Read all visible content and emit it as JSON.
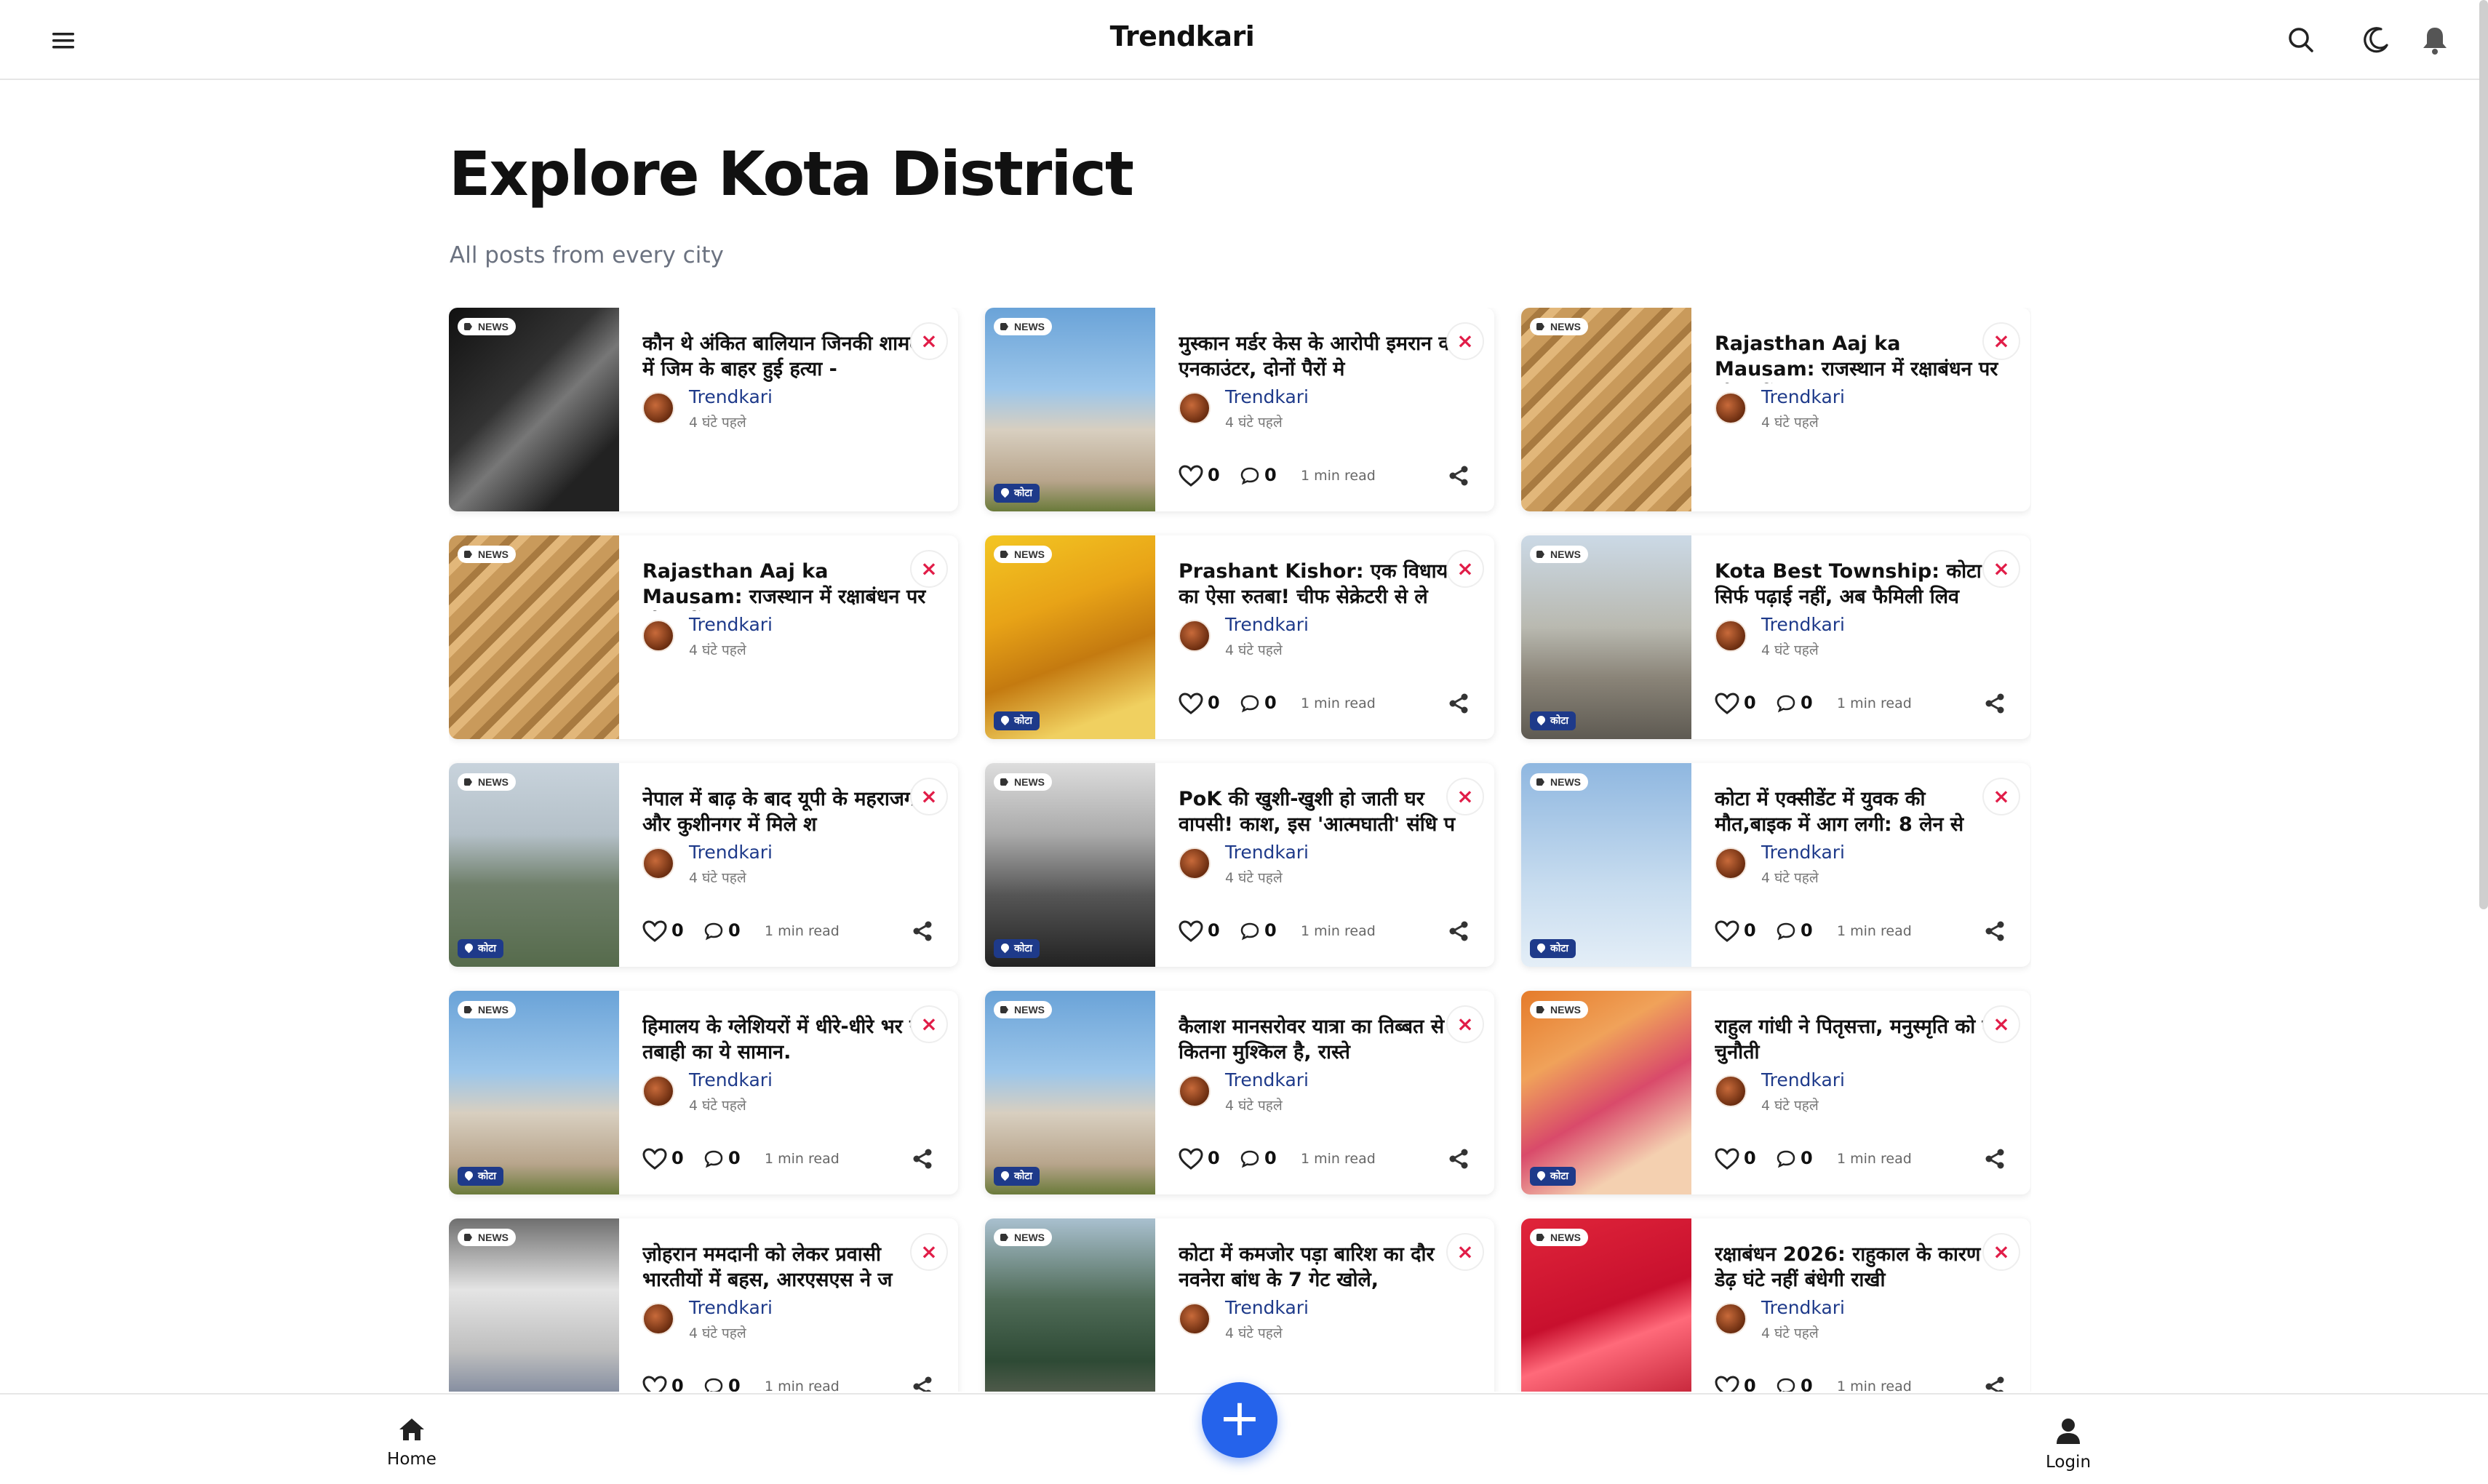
{
  "header": {
    "brand": "Trendkari"
  },
  "hero": {
    "title": "Explore Kota District",
    "subtitle": "All posts from every city"
  },
  "cards": [
    {
      "tag": "NEWS",
      "location": "",
      "title": "कौन थे अंकित बालियान जिनकी शामली में जिम के बाहर हुई हत्या -",
      "author": "Trendkari",
      "time": "4 घंटे पहले",
      "likes": "",
      "comments": "",
      "read": "",
      "theme": "gym"
    },
    {
      "tag": "NEWS",
      "location": "कोटा",
      "title": "मुस्कान मर्डर केस के आरोपी इमरान का एनकाउंटर, दोनों पैरों मे",
      "author": "Trendkari",
      "time": "4 घंटे पहले",
      "likes": "0",
      "comments": "0",
      "read": "1 min read",
      "theme": "taj"
    },
    {
      "tag": "NEWS",
      "location": "",
      "title": "Rajasthan Aaj ka Mausam: राजस्थान में रक्षाबंधन पर भी बरसेंग",
      "author": "Trendkari",
      "time": "4 घंटे पहले",
      "likes": "",
      "comments": "",
      "read": "",
      "theme": "stepwell"
    },
    {
      "tag": "NEWS",
      "location": "",
      "title": "Rajasthan Aaj ka Mausam: राजस्थान में रक्षाबंधन पर भी बरसेंग",
      "author": "Trendkari",
      "time": "4 घंटे पहले",
      "likes": "",
      "comments": "",
      "read": "",
      "theme": "stepwell"
    },
    {
      "tag": "NEWS",
      "location": "कोटा",
      "title": "Prashant Kishor: एक विधायक का ऐसा रुतबा! चीफ सेक्रेटरी से ले",
      "author": "Trendkari",
      "time": "4 घंटे पहले",
      "likes": "0",
      "comments": "0",
      "read": "1 min read",
      "theme": "crowd"
    },
    {
      "tag": "NEWS",
      "location": "कोटा",
      "title": "Kota Best Township: कोटा में सिर्फ पढ़ाई नहीं, अब फैमिली लिव",
      "author": "Trendkari",
      "time": "4 घंटे पहले",
      "likes": "0",
      "comments": "0",
      "read": "1 min read",
      "theme": "street"
    },
    {
      "tag": "NEWS",
      "location": "कोटा",
      "title": "नेपाल में बाढ़ के बाद यूपी के महराजगंज और कुशीनगर में मिले श",
      "author": "Trendkari",
      "time": "4 घंटे पहले",
      "likes": "0",
      "comments": "0",
      "read": "1 min read",
      "theme": "flood"
    },
    {
      "tag": "NEWS",
      "location": "कोटा",
      "title": "PoK की खुशी-खुशी हो जाती घर वापसी! काश, इस 'आत्मघाती' संधि प",
      "author": "Trendkari",
      "time": "4 घंटे पहले",
      "likes": "0",
      "comments": "0",
      "read": "1 min read",
      "theme": "protest"
    },
    {
      "tag": "NEWS",
      "location": "कोटा",
      "title": "कोटा में एक्सीडेंट में युवक की मौत,बाइक में आग लगी: 8 लेन से",
      "author": "Trendkari",
      "time": "4 घंटे पहले",
      "likes": "0",
      "comments": "0",
      "read": "1 min read",
      "theme": "plane"
    },
    {
      "tag": "NEWS",
      "location": "कोटा",
      "title": "हिमालय के ग्लेशियरों में धीरे-धीरे भर रहा तबाही का ये सामान.",
      "author": "Trendkari",
      "time": "4 घंटे पहले",
      "likes": "0",
      "comments": "0",
      "read": "1 min read",
      "theme": "taj"
    },
    {
      "tag": "NEWS",
      "location": "कोटा",
      "title": "कैलाश मानसरोवर यात्रा का तिब्बत से कितना मुश्किल है, रास्ते",
      "author": "Trendkari",
      "time": "4 घंटे पहले",
      "likes": "0",
      "comments": "0",
      "read": "1 min read",
      "theme": "taj"
    },
    {
      "tag": "NEWS",
      "location": "कोटा",
      "title": "राहुल गांधी ने पितृसत्ता, मनुस्मृति को दी चुनौती",
      "author": "Trendkari",
      "time": "4 घंटे पहले",
      "likes": "0",
      "comments": "0",
      "read": "1 min read",
      "theme": "rally"
    },
    {
      "tag": "NEWS",
      "location": "",
      "title": "ज़ोहरान ममदानी को लेकर प्रवासी भारतीयों में बहस, आरएसएस ने ज",
      "author": "Trendkari",
      "time": "4 घंटे पहले",
      "likes": "0",
      "comments": "0",
      "read": "1 min read",
      "theme": "sign"
    },
    {
      "tag": "NEWS",
      "location": "",
      "title": "कोटा में कमजोर पड़ा बारिश का दौर नवनेरा बांध के 7 गेट खोले,",
      "author": "Trendkari",
      "time": "4 घंटे पहले",
      "likes": "",
      "comments": "",
      "read": "",
      "theme": "rain"
    },
    {
      "tag": "NEWS",
      "location": "",
      "title": "रक्षाबंधन 2026: राहुकाल के कारण डेढ़ घंटे नहीं बंधेगी राखी",
      "author": "Trendkari",
      "time": "4 घंटे पहले",
      "likes": "0",
      "comments": "0",
      "read": "1 min read",
      "theme": "red"
    }
  ],
  "nav": {
    "home_label": "Home",
    "login_label": "Login",
    "add_symbol": "+"
  }
}
